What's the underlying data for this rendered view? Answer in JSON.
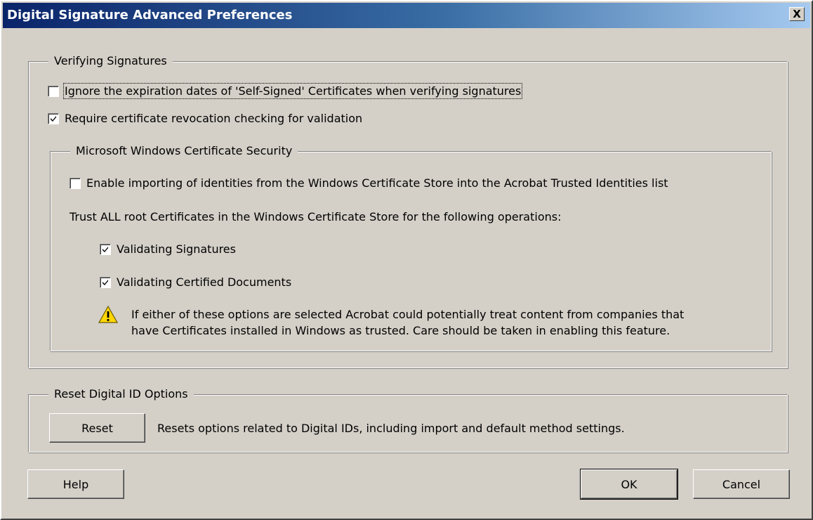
{
  "window": {
    "title": "Digital Signature Advanced Preferences",
    "close_symbol": "X"
  },
  "verifying": {
    "legend": "Verifying Signatures",
    "ignore_expiration": {
      "label": "Ignore the expiration dates of 'Self-Signed' Certificates when verifying signatures",
      "checked": false
    },
    "require_revocation": {
      "label": "Require certificate revocation checking for validation",
      "checked": true
    }
  },
  "windows_security": {
    "legend": "Microsoft Windows Certificate Security",
    "enable_import": {
      "label": "Enable importing of identities from the Windows Certificate Store into the Acrobat Trusted Identities list",
      "checked": false
    },
    "trust_text": "Trust ALL root Certificates in the Windows Certificate Store for the following operations:",
    "validating_signatures": {
      "label": "Validating Signatures",
      "checked": true
    },
    "validating_certified": {
      "label": "Validating Certified Documents",
      "checked": true
    },
    "warning_icon": "warning-triangle-icon",
    "warning_line1": "If either of these options are selected Acrobat could potentially treat content from companies that",
    "warning_line2": "have Certificates installed in Windows as trusted. Care should be taken in enabling this feature."
  },
  "reset": {
    "legend": "Reset Digital ID Options",
    "button_label": "Reset",
    "description": "Resets options related to Digital IDs, including import and default method settings."
  },
  "footer": {
    "help_label": "Help",
    "ok_label": "OK",
    "cancel_label": "Cancel"
  },
  "colors": {
    "dialog_bg": "#d4d0c8",
    "titlebar_start": "#0a246a",
    "titlebar_end": "#a6caf0",
    "warning_fill": "#ffd700"
  }
}
